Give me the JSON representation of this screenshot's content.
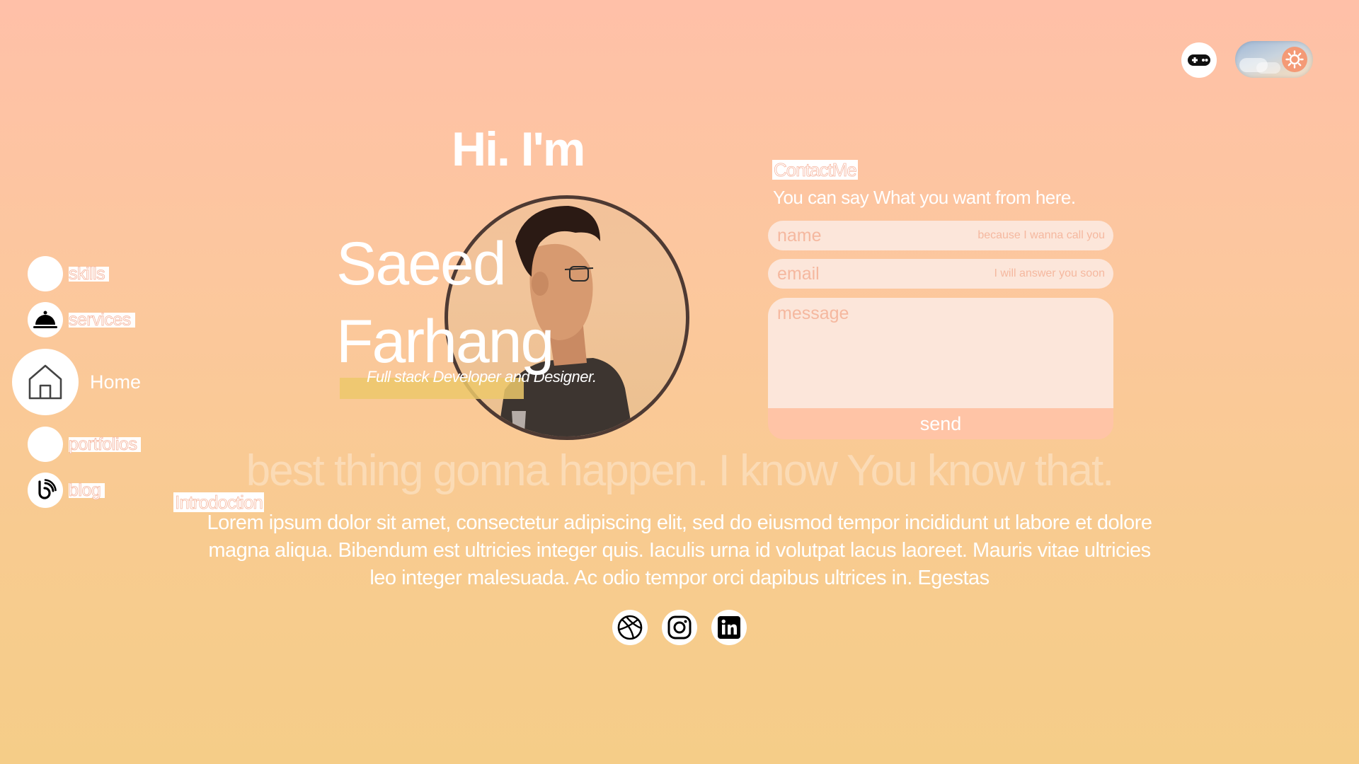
{
  "header": {
    "game_button_icon": "gamepad-icon",
    "theme_toggle_icon": "sun-icon"
  },
  "nav": {
    "items": [
      {
        "label": "skills",
        "icon": "blank"
      },
      {
        "label": "services",
        "icon": "service-bell-icon"
      },
      {
        "label": "Home",
        "icon": "home-icon",
        "active": true
      },
      {
        "label": "portfolios",
        "icon": "blank"
      },
      {
        "label": "blog",
        "icon": "blog-icon"
      }
    ]
  },
  "hero": {
    "greeting": "Hi. I'm",
    "first_name": "Saeed",
    "last_name": "Farhang",
    "tagline": "Full stack Developer and Designer."
  },
  "contact": {
    "title": "ContactMe",
    "subtitle": "You can say What you want from here.",
    "name_placeholder": "name",
    "name_hint": "because I wanna call you",
    "email_placeholder": "email",
    "email_hint": "I will answer you soon",
    "message_placeholder": "message",
    "send_label": "send"
  },
  "slogan": "best thing gonna happen. I know You know that.",
  "intro": {
    "title": "Introdoction",
    "body": "Lorem ipsum dolor sit amet, consectetur adipiscing elit, sed do eiusmod tempor incididunt ut labore et dolore magna aliqua. Bibendum est ultricies integer quis. Iaculis urna id volutpat lacus laoreet. Mauris vitae ultricies leo integer malesuada. Ac odio tempor orci dapibus ultrices in. Egestas"
  },
  "socials": [
    {
      "name": "dribbble",
      "icon": "dribbble-icon"
    },
    {
      "name": "instagram",
      "icon": "instagram-icon"
    },
    {
      "name": "linkedin",
      "icon": "linkedin-icon"
    }
  ],
  "colors": {
    "background_top": "#ffc0a8",
    "background_bottom": "#f5cd88",
    "field_bg": "#fce6da",
    "placeholder": "#f5b89f",
    "send_bg": "#ffc4a6",
    "avatar_border": "#4e3a33",
    "accent_sun": "#f49a76"
  }
}
